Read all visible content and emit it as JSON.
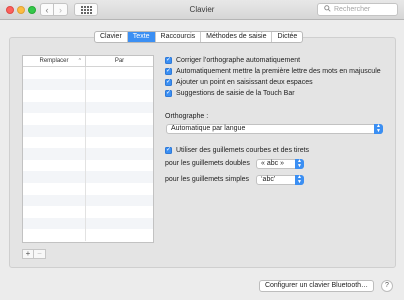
{
  "window": {
    "title": "Clavier"
  },
  "toolbar": {
    "back_glyph": "‹",
    "forward_glyph": "›",
    "search_placeholder": "Rechercher"
  },
  "tabs": [
    {
      "label": "Clavier"
    },
    {
      "label": "Texte"
    },
    {
      "label": "Raccourcis"
    },
    {
      "label": "Méthodes de saisie"
    },
    {
      "label": "Dictée"
    }
  ],
  "active_tab": "Texte",
  "table": {
    "headers": {
      "replace": "Remplacer",
      "with": "Par"
    },
    "sort_glyph": "^",
    "rows": []
  },
  "table_controls": {
    "add": "+",
    "remove": "−"
  },
  "options": {
    "autocorrect": {
      "label": "Corriger l’orthographe automatiquement",
      "checked": true
    },
    "capitalize": {
      "label": "Automatiquement mettre la première lettre des mots en majuscule",
      "checked": true
    },
    "double_space_period": {
      "label": "Ajouter un point en saisissant deux espaces",
      "checked": true
    },
    "touchbar_suggestions": {
      "label": "Suggestions de saisie de la Touch Bar",
      "checked": true
    }
  },
  "spelling": {
    "label": "Orthographe :",
    "value": "Automatique par langue"
  },
  "smart_quotes": {
    "label": "Utiliser des guillemets courbes et des tirets",
    "checked": true,
    "double_label": "pour les guillemets doubles",
    "double_value": "« abc »",
    "single_label": "pour les guillemets simples",
    "single_value": "‘abc’"
  },
  "footer": {
    "bluetooth_button": "Configurer un clavier Bluetooth…",
    "help": "?"
  },
  "colors": {
    "accent": "#3b8ff3",
    "close": "#fc605c",
    "minimize": "#fdbc40",
    "maximize": "#34c84a"
  }
}
